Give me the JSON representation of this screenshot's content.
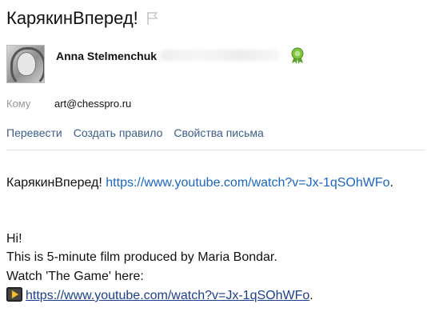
{
  "header": {
    "subject": "КарякинВперед!",
    "flag_icon": "flag-icon"
  },
  "sender": {
    "name": "Anna Stelmenchuk",
    "badge_icon": "ribbon-badge-icon"
  },
  "recipient": {
    "label": "Кому",
    "value": "art@chesspro.ru"
  },
  "actions": [
    {
      "label": "Перевести"
    },
    {
      "label": "Создать правило"
    },
    {
      "label": "Свойства письма"
    }
  ],
  "message": {
    "line1_prefix": "КарякинВперед! ",
    "line1_link": "https://www.youtube.com/watch?v=Jx-1qSOhWFo",
    "line1_suffix": ".",
    "greeting": "Hi!",
    "line2": "This is 5-minute film produced by Maria Bondar.",
    "line3": "Watch 'The Game' here:",
    "line4_link": "https://www.youtube.com/watch?v=Jx-1qSOhWFo",
    "line4_suffix": ".",
    "play_icon": "video-play-icon"
  },
  "colors": {
    "link": "#1a66c2",
    "action": "#3c5e8a",
    "label": "#999999"
  }
}
